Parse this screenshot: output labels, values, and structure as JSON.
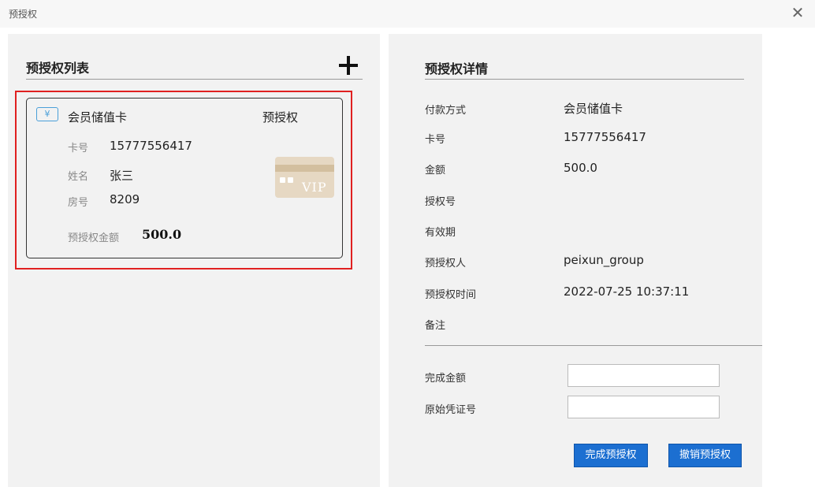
{
  "window": {
    "title": "预授权",
    "close_label": "✕"
  },
  "left": {
    "heading": "预授权列表",
    "card": {
      "payment_type": "会员储值卡",
      "currency_icon": "¥",
      "status": "预授权",
      "card_no_label": "卡号",
      "card_no": "15777556417",
      "name_label": "姓名",
      "name": "张三",
      "room_label": "房号",
      "room": "8209",
      "amount_label": "预授权金额",
      "amount": "500.0",
      "vip_text": "VIP"
    }
  },
  "right": {
    "heading": "预授权详情",
    "rows": [
      {
        "label": "付款方式",
        "value": "会员储值卡"
      },
      {
        "label": "卡号",
        "value": "15777556417"
      },
      {
        "label": "金额",
        "value": "500.0"
      },
      {
        "label": "授权号",
        "value": ""
      },
      {
        "label": "有效期",
        "value": ""
      },
      {
        "label": "预授权人",
        "value": "peixun_group"
      },
      {
        "label": "预授权时间",
        "value": "2022-07-25 10:37:11"
      },
      {
        "label": "备注",
        "value": ""
      }
    ],
    "complete_amount_label": "完成金额",
    "complete_amount_value": "",
    "voucher_label": "原始凭证号",
    "voucher_value": "",
    "complete_button": "完成预授权",
    "cancel_button": "撤销预授权"
  },
  "colors": {
    "accent": "#1c6fd1",
    "selection": "#e02020",
    "icon_blue": "#4a9fd8",
    "vip_gold": "#e6d8c3"
  },
  "icons": {
    "close": "close-icon",
    "add": "plus-icon",
    "card": "currency-card-icon",
    "vip": "vip-card-icon"
  }
}
